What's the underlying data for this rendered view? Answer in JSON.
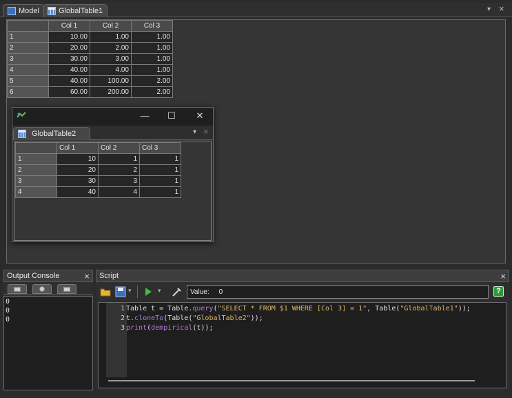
{
  "tabs": [
    {
      "label": "Model",
      "icon": "model-icon"
    },
    {
      "label": "GlobalTable1",
      "icon": "table-icon"
    }
  ],
  "tabbar_controls": {
    "menu": "▾",
    "close": "×"
  },
  "global_table1": {
    "columns": [
      "Col 1",
      "Col 2",
      "Col 3"
    ],
    "rows": [
      {
        "label": "1",
        "values": [
          "10.00",
          "1.00",
          "1.00"
        ]
      },
      {
        "label": "2",
        "values": [
          "20.00",
          "2.00",
          "1.00"
        ]
      },
      {
        "label": "3",
        "values": [
          "30.00",
          "3.00",
          "1.00"
        ]
      },
      {
        "label": "4",
        "values": [
          "40.00",
          "4.00",
          "1.00"
        ]
      },
      {
        "label": "5",
        "values": [
          "40.00",
          "100.00",
          "2.00"
        ]
      },
      {
        "label": "6",
        "values": [
          "60.00",
          "200.00",
          "2.00"
        ]
      }
    ]
  },
  "float_window": {
    "buttons": {
      "minimize": "—",
      "maximize": "☐",
      "close": "✕"
    },
    "tab_label": "GlobalTable2",
    "tab_controls": {
      "menu": "▾",
      "close": "×"
    },
    "table": {
      "columns": [
        "Col 1",
        "Col 2",
        "Col 3"
      ],
      "rows": [
        {
          "label": "1",
          "values": [
            "10",
            "1",
            "1"
          ]
        },
        {
          "label": "2",
          "values": [
            "20",
            "2",
            "1"
          ]
        },
        {
          "label": "3",
          "values": [
            "30",
            "3",
            "1"
          ]
        },
        {
          "label": "4",
          "values": [
            "40",
            "4",
            "1"
          ]
        }
      ]
    }
  },
  "console": {
    "title": "Output Console",
    "close": "×",
    "lines": [
      "0",
      "0",
      "0"
    ]
  },
  "script": {
    "title": "Script",
    "close": "×",
    "value_label": "Value:",
    "value": "0",
    "help": "?",
    "lines": [
      {
        "n": "1",
        "parts": [
          {
            "t": "Table t = Table.",
            "c": "kw"
          },
          {
            "t": "query",
            "c": "fn"
          },
          {
            "t": "(",
            "c": "kw"
          },
          {
            "t": "\"SELECT * FROM $1 WHERE [Col 3] = 1\"",
            "c": "str"
          },
          {
            "t": ", Table(",
            "c": "kw"
          },
          {
            "t": "\"GlobalTable1\"",
            "c": "str"
          },
          {
            "t": "));",
            "c": "kw"
          }
        ]
      },
      {
        "n": "2",
        "parts": [
          {
            "t": "t.",
            "c": "kw"
          },
          {
            "t": "cloneTo",
            "c": "fn"
          },
          {
            "t": "(Table(",
            "c": "kw"
          },
          {
            "t": "\"GlobalTable2\"",
            "c": "str"
          },
          {
            "t": "));",
            "c": "kw"
          }
        ]
      },
      {
        "n": "3",
        "parts": [
          {
            "t": "print",
            "c": "fn"
          },
          {
            "t": "(",
            "c": "kw"
          },
          {
            "t": "dempirical",
            "c": "fn"
          },
          {
            "t": "(t));",
            "c": "kw"
          }
        ]
      }
    ]
  }
}
